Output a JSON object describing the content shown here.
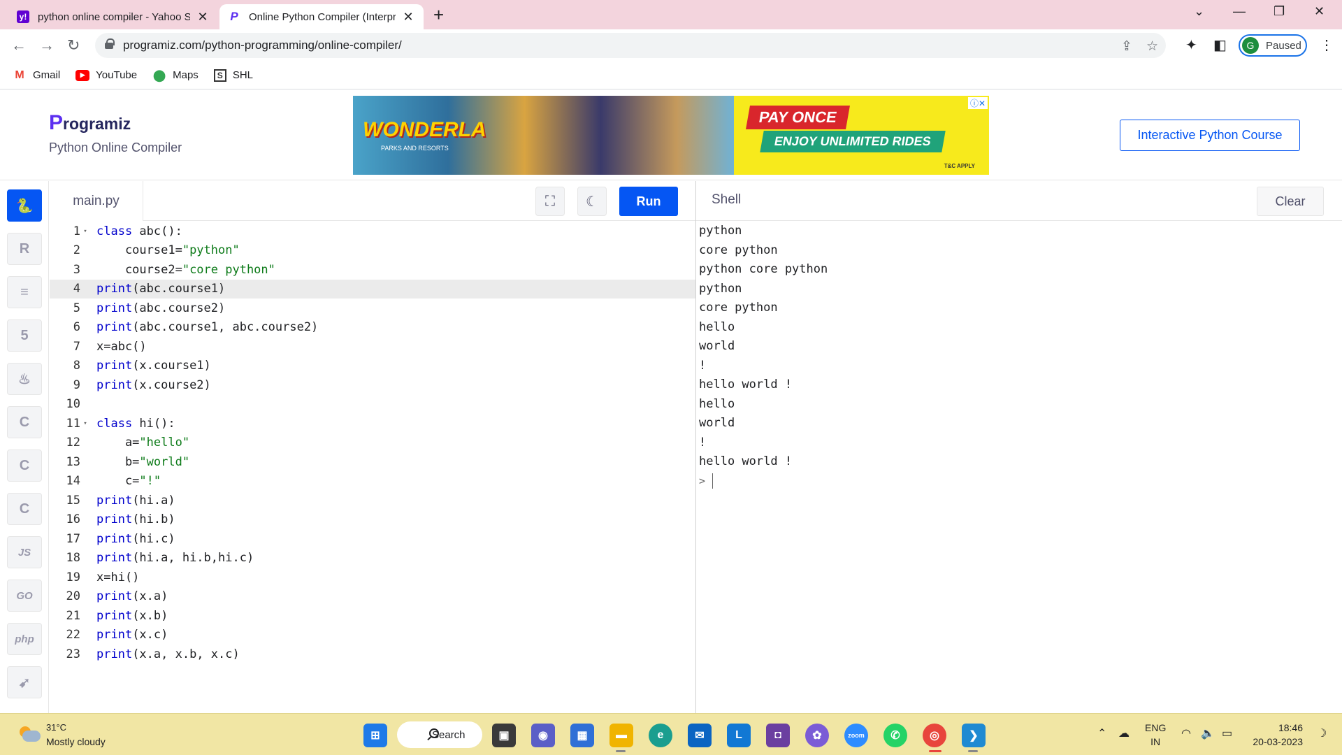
{
  "browser": {
    "tabs": [
      {
        "title": "python online compiler - Yahoo S",
        "favicon": "yahoo-icon",
        "active": false
      },
      {
        "title": "Online Python Compiler (Interpre",
        "favicon": "programiz-icon",
        "active": true
      }
    ],
    "url": "programiz.com/python-programming/online-compiler/",
    "profile_initial": "G",
    "profile_status": "Paused",
    "bookmarks": [
      {
        "label": "Gmail",
        "icon": "gmail-icon"
      },
      {
        "label": "YouTube",
        "icon": "youtube-icon"
      },
      {
        "label": "Maps",
        "icon": "maps-icon"
      },
      {
        "label": "SHL",
        "icon": "shl-icon"
      }
    ]
  },
  "site": {
    "logo_initial": "P",
    "logo_rest": "rogramiz",
    "subtitle": "Python Online Compiler",
    "course_button": "Interactive Python Course",
    "ad": {
      "brand": "WONDERLA",
      "brand_sub": "PARKS AND RESORTS",
      "headline": "PAY ONCE",
      "tagline": "ENJOY UNLIMITED RIDES",
      "fine_print": "T&C APPLY"
    }
  },
  "rail": {
    "items": [
      {
        "name": "python",
        "glyph": "🐍",
        "active": true
      },
      {
        "name": "r",
        "glyph": "R"
      },
      {
        "name": "sql",
        "glyph": "≡"
      },
      {
        "name": "html",
        "glyph": "5"
      },
      {
        "name": "java",
        "glyph": "♨"
      },
      {
        "name": "c",
        "glyph": "C"
      },
      {
        "name": "cpp",
        "glyph": "C"
      },
      {
        "name": "csharp",
        "glyph": "C"
      },
      {
        "name": "js",
        "glyph": "JS"
      },
      {
        "name": "go",
        "glyph": "GO"
      },
      {
        "name": "php",
        "glyph": "php"
      },
      {
        "name": "swift",
        "glyph": "➹"
      }
    ]
  },
  "editor": {
    "filename": "main.py",
    "run_label": "Run",
    "highlighted_line": 4,
    "lines": [
      "class abc():",
      "    course1=\"python\"",
      "    course2=\"core python\"",
      "print(abc.course1)",
      "print(abc.course2)",
      "print(abc.course1, abc.course2)",
      "x=abc()",
      "print(x.course1)",
      "print(x.course2)",
      "",
      "class hi():",
      "    a=\"hello\"",
      "    b=\"world\"",
      "    c=\"!\"",
      "print(hi.a)",
      "print(hi.b)",
      "print(hi.c)",
      "print(hi.a, hi.b,hi.c)",
      "x=hi()",
      "print(x.a)",
      "print(x.b)",
      "print(x.c)",
      "print(x.a, x.b, x.c)"
    ],
    "fold_lines": [
      1,
      11
    ]
  },
  "shell": {
    "title": "Shell",
    "clear_label": "Clear",
    "output": [
      "python",
      "core python",
      "python core python",
      "python",
      "core python",
      "hello",
      "world",
      "!",
      "hello world !",
      "hello",
      "world",
      "!",
      "hello world !"
    ],
    "prompt": ">"
  },
  "taskbar": {
    "temperature": "31°C",
    "condition": "Mostly cloudy",
    "search_label": "Search",
    "language_top": "ENG",
    "language_bottom": "IN",
    "time": "18:46",
    "date": "20-03-2023"
  }
}
